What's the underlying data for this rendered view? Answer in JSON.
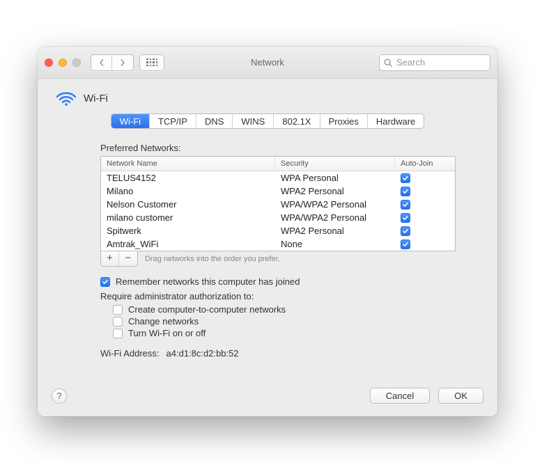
{
  "window": {
    "title": "Network",
    "search_placeholder": "Search"
  },
  "header": {
    "title": "Wi-Fi"
  },
  "tabs": {
    "items": [
      {
        "label": "Wi-Fi",
        "active": true
      },
      {
        "label": "TCP/IP"
      },
      {
        "label": "DNS"
      },
      {
        "label": "WINS"
      },
      {
        "label": "802.1X"
      },
      {
        "label": "Proxies"
      },
      {
        "label": "Hardware"
      }
    ]
  },
  "preferred": {
    "label": "Preferred Networks:",
    "columns": {
      "name": "Network Name",
      "security": "Security",
      "autojoin": "Auto-Join"
    },
    "rows": [
      {
        "name": "TELUS4152",
        "security": "WPA Personal",
        "auto": true
      },
      {
        "name": "Milano",
        "security": "WPA2 Personal",
        "auto": true
      },
      {
        "name": "Nelson Customer",
        "security": "WPA/WPA2 Personal",
        "auto": true
      },
      {
        "name": "milano customer",
        "security": "WPA/WPA2 Personal",
        "auto": true
      },
      {
        "name": "Spitwerk",
        "security": "WPA2 Personal",
        "auto": true
      },
      {
        "name": "Amtrak_WiFi",
        "security": "None",
        "auto": true
      }
    ],
    "add": "+",
    "remove": "−",
    "drag_hint": "Drag networks into the order you prefer."
  },
  "options": {
    "remember": {
      "label": "Remember networks this computer has joined",
      "checked": true
    },
    "require_label": "Require administrator authorization to:",
    "create": {
      "label": "Create computer-to-computer networks",
      "checked": false
    },
    "change": {
      "label": "Change networks",
      "checked": false
    },
    "turn": {
      "label": "Turn Wi-Fi on or off",
      "checked": false
    }
  },
  "address": {
    "label": "Wi-Fi Address:",
    "value": "a4:d1:8c:d2:bb:52"
  },
  "footer": {
    "help": "?",
    "cancel": "Cancel",
    "ok": "OK"
  }
}
